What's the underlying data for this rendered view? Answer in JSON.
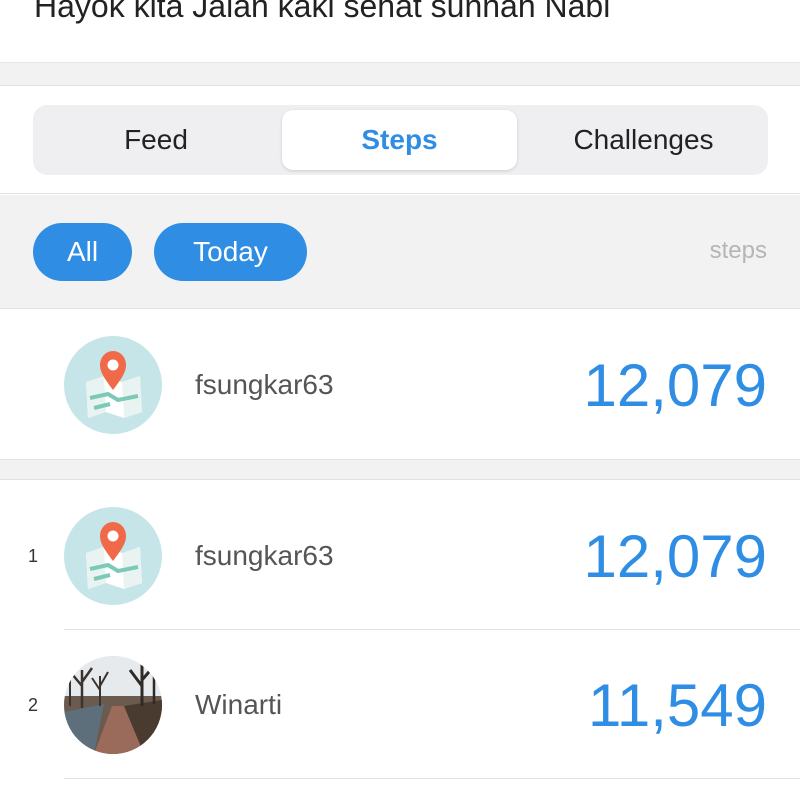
{
  "header": {
    "title": "Hayok kita Jalan kaki sehat sunnah Nabi"
  },
  "tabs": {
    "feed": "Feed",
    "steps": "Steps",
    "challenges": "Challenges",
    "active": "Steps"
  },
  "filters": {
    "all": "All",
    "today": "Today",
    "unit_label": "steps"
  },
  "current_user": {
    "username": "fsungkar63",
    "steps": "12,079",
    "avatar": "map-pin-icon"
  },
  "leaderboard": [
    {
      "rank": "1",
      "username": "fsungkar63",
      "steps": "12,079",
      "avatar": "map-pin-icon"
    },
    {
      "rank": "2",
      "username": "Winarti",
      "steps": "11,549",
      "avatar": "photo-path-trees"
    }
  ],
  "colors": {
    "accent": "#2f8ee3",
    "band": "#f2f2f2",
    "avatar_bg": "#c5e5e8",
    "pin": "#f06a4a"
  }
}
